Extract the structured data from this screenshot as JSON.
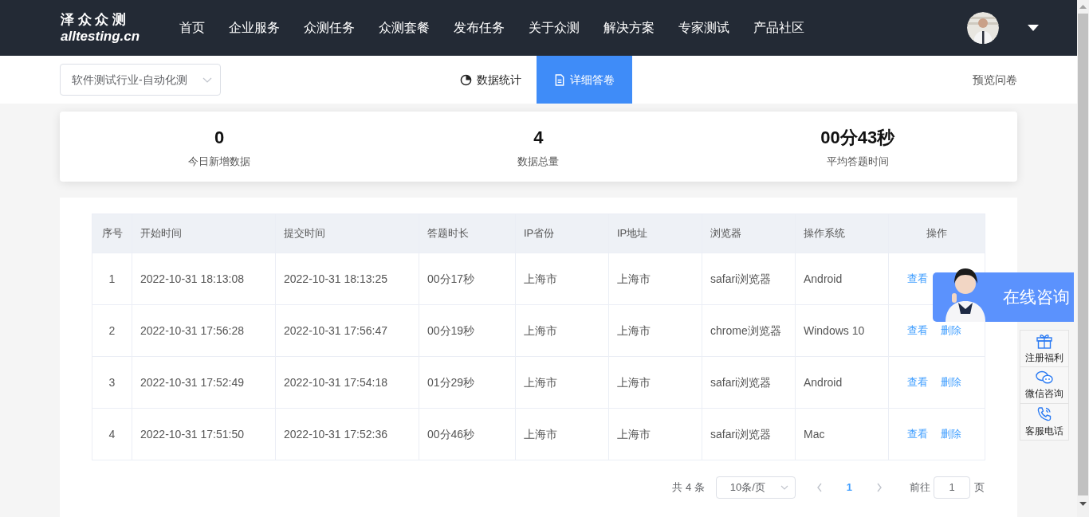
{
  "logo": {
    "title": "泽 众 众 测",
    "domain": "alltesting.cn"
  },
  "nav": {
    "items": [
      "首页",
      "企业服务",
      "众测任务",
      "众测套餐",
      "发布任务",
      "关于众测",
      "解决方案",
      "专家测试",
      "产品社区"
    ]
  },
  "survey_select": {
    "value": "软件测试行业-自动化测"
  },
  "tabs": [
    {
      "label": "数据统计",
      "kind": "pie",
      "selected": false
    },
    {
      "label": "详细答卷",
      "kind": "doc",
      "selected": true
    }
  ],
  "preview_link": "预览问卷",
  "stats": [
    {
      "value": "0",
      "label": "今日新增数据"
    },
    {
      "value": "4",
      "label": "数据总量"
    },
    {
      "value": "00分43秒",
      "label": "平均答题时间"
    }
  ],
  "table": {
    "columns": [
      "序号",
      "开始时间",
      "提交时间",
      "答题时长",
      "IP省份",
      "IP地址",
      "浏览器",
      "操作系统",
      "操作"
    ],
    "rows": [
      {
        "cells": [
          "1",
          "2022-10-31 18:13:08",
          "2022-10-31 18:13:25",
          "00分17秒",
          "上海市",
          "上海市",
          "safari浏览器",
          "Android"
        ],
        "actions": [
          "查看"
        ]
      },
      {
        "cells": [
          "2",
          "2022-10-31 17:56:28",
          "2022-10-31 17:56:47",
          "00分19秒",
          "上海市",
          "上海市",
          "chrome浏览器",
          "Windows 10"
        ],
        "actions": [
          "查看",
          "删除"
        ]
      },
      {
        "cells": [
          "3",
          "2022-10-31 17:52:49",
          "2022-10-31 17:54:18",
          "01分29秒",
          "上海市",
          "上海市",
          "safari浏览器",
          "Android"
        ],
        "actions": [
          "查看",
          "删除"
        ]
      },
      {
        "cells": [
          "4",
          "2022-10-31 17:51:50",
          "2022-10-31 17:52:36",
          "00分46秒",
          "上海市",
          "上海市",
          "safari浏览器",
          "Mac"
        ],
        "actions": [
          "查看",
          "删除"
        ]
      }
    ]
  },
  "pagination": {
    "total": "共 4 条",
    "page_size": "10条/页",
    "pages": [
      {
        "label": "1",
        "selected": true
      }
    ],
    "goto_label": "前往",
    "goto_value": "1",
    "goto_suffix": "页"
  },
  "consult": {
    "label": "在线咨询"
  },
  "side_tools": [
    {
      "label": "注册福利",
      "kind": "gift"
    },
    {
      "label": "微信咨询",
      "kind": "chat"
    },
    {
      "label": "客服电话",
      "kind": "phone"
    }
  ]
}
